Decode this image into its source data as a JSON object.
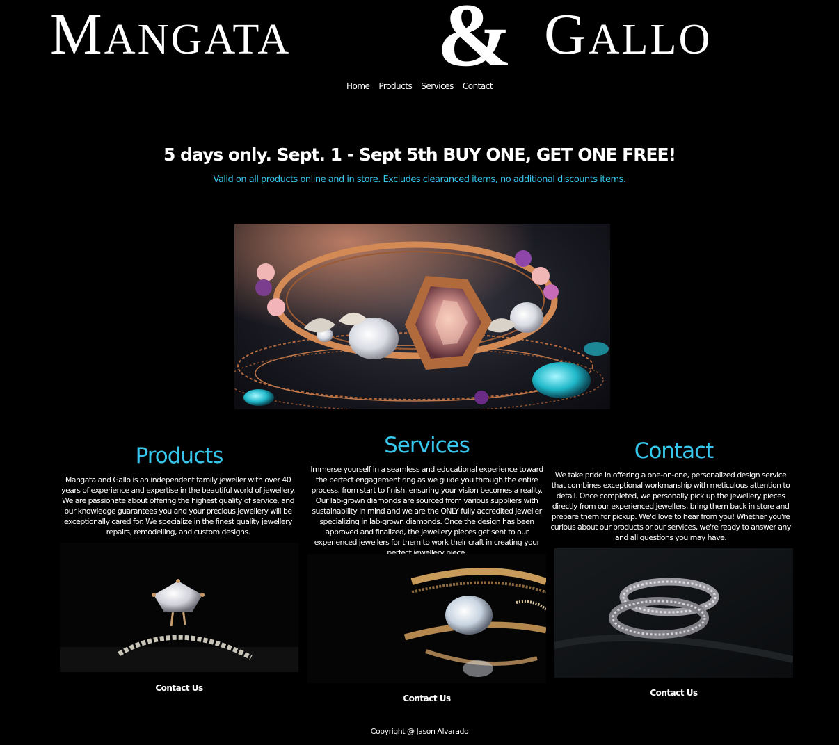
{
  "brand": {
    "word1": "Mangata",
    "ampersand": "&",
    "word2": "Gallo"
  },
  "nav": {
    "items": [
      "Home",
      "Products",
      "Services",
      "Contact"
    ]
  },
  "promo": {
    "title": "5 days only. Sept. 1 - Sept 5th BUY ONE, GET ONE FREE!",
    "subtitle": "Valid on all products online and in store. Excludes clearanced items, no additional discounts items."
  },
  "sections": [
    {
      "heading": "Products",
      "text": "Mangata and Gallo is an independent family jeweller with over 40 years of experience and expertise in the beautiful world of jewellery. We are passionate about offering the highest quality of service, and our knowledge guarantees you and your precious jewellery will be exceptionally cared for. We specialize in the finest quality jewellery repairs, remodelling, and custom designs.",
      "cta": "Contact Us"
    },
    {
      "heading": "Services",
      "text": "Immerse yourself in a seamless and educational experience toward the perfect engagement ring as we guide you through the entire process, from start to finish, ensuring your vision becomes a reality. Our lab-grown diamonds are sourced from various suppliers with sustainability in mind and we are the ONLY fully accredited jeweller specializing in lab-grown diamonds. Once the design has been approved and finalized, the jewellery pieces get sent to our experienced jewellers for them to work their craft in creating your perfect jewellery piece.",
      "cta": "Contact Us"
    },
    {
      "heading": "Contact",
      "text": "We take pride in offering a one-on-one, personalized design service that combines exceptional workmanship with meticulous attention to detail. Once completed, we personally pick up the jewellery pieces directly from our experienced jewellers, bring them back in store and prepare them for pickup. We'd love to hear from you! Whether you're curious about our products or our services, we're ready to answer any and all questions you may have.",
      "cta": "Contact Us"
    }
  ],
  "footer": {
    "copyright": "Copyright @ Jason Alvarado"
  },
  "colors": {
    "background": "#000000",
    "accent": "#37c7ec",
    "text": "#ffffff"
  }
}
